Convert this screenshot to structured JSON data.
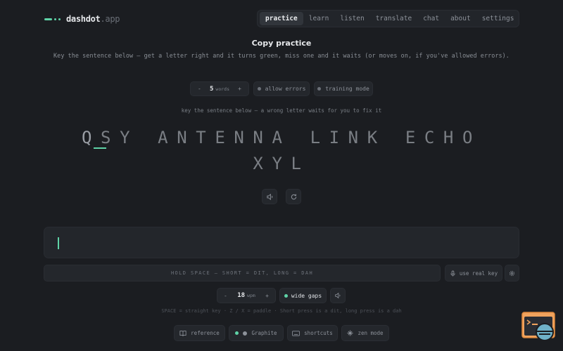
{
  "brand": {
    "name": "dashdot",
    "ext": ".app",
    "accent": "#5fd3a7"
  },
  "nav": [
    {
      "label": "practice",
      "active": true
    },
    {
      "label": "learn"
    },
    {
      "label": "listen"
    },
    {
      "label": "translate"
    },
    {
      "label": "chat"
    },
    {
      "label": "about"
    },
    {
      "label": "settings"
    }
  ],
  "page": {
    "title": "Copy practice",
    "subtitle": "Key the sentence below — get a letter right and it turns green, miss one and it waits (or moves on, if you've allowed errors)."
  },
  "options": {
    "words_value": "5",
    "words_unit": "words",
    "minus": "-",
    "plus": "+",
    "allow_errors": "allow errors",
    "training_mode": "training mode"
  },
  "hint": "key the sentence below — a wrong letter waits for you to fix it",
  "sentence": {
    "first_letter": "Q",
    "line1_rest": "SY ANTENNA LINK ECHO",
    "line2": "XYL"
  },
  "input": {
    "value": ""
  },
  "keyer": {
    "hold_space": "HOLD SPACE — SHORT = DIT, LONG = DAH",
    "real_key": "use real key"
  },
  "speed": {
    "value": "18",
    "unit": "wpm",
    "minus": "-",
    "plus": "+",
    "wide_gaps": "wide gaps"
  },
  "keys_hint": "SPACE = straight key · Z / X = paddle · Short press is a dit, long press is a dah",
  "footer": {
    "reference": "reference",
    "theme": "Graphite",
    "shortcuts": "shortcuts",
    "zen": "zen mode"
  }
}
